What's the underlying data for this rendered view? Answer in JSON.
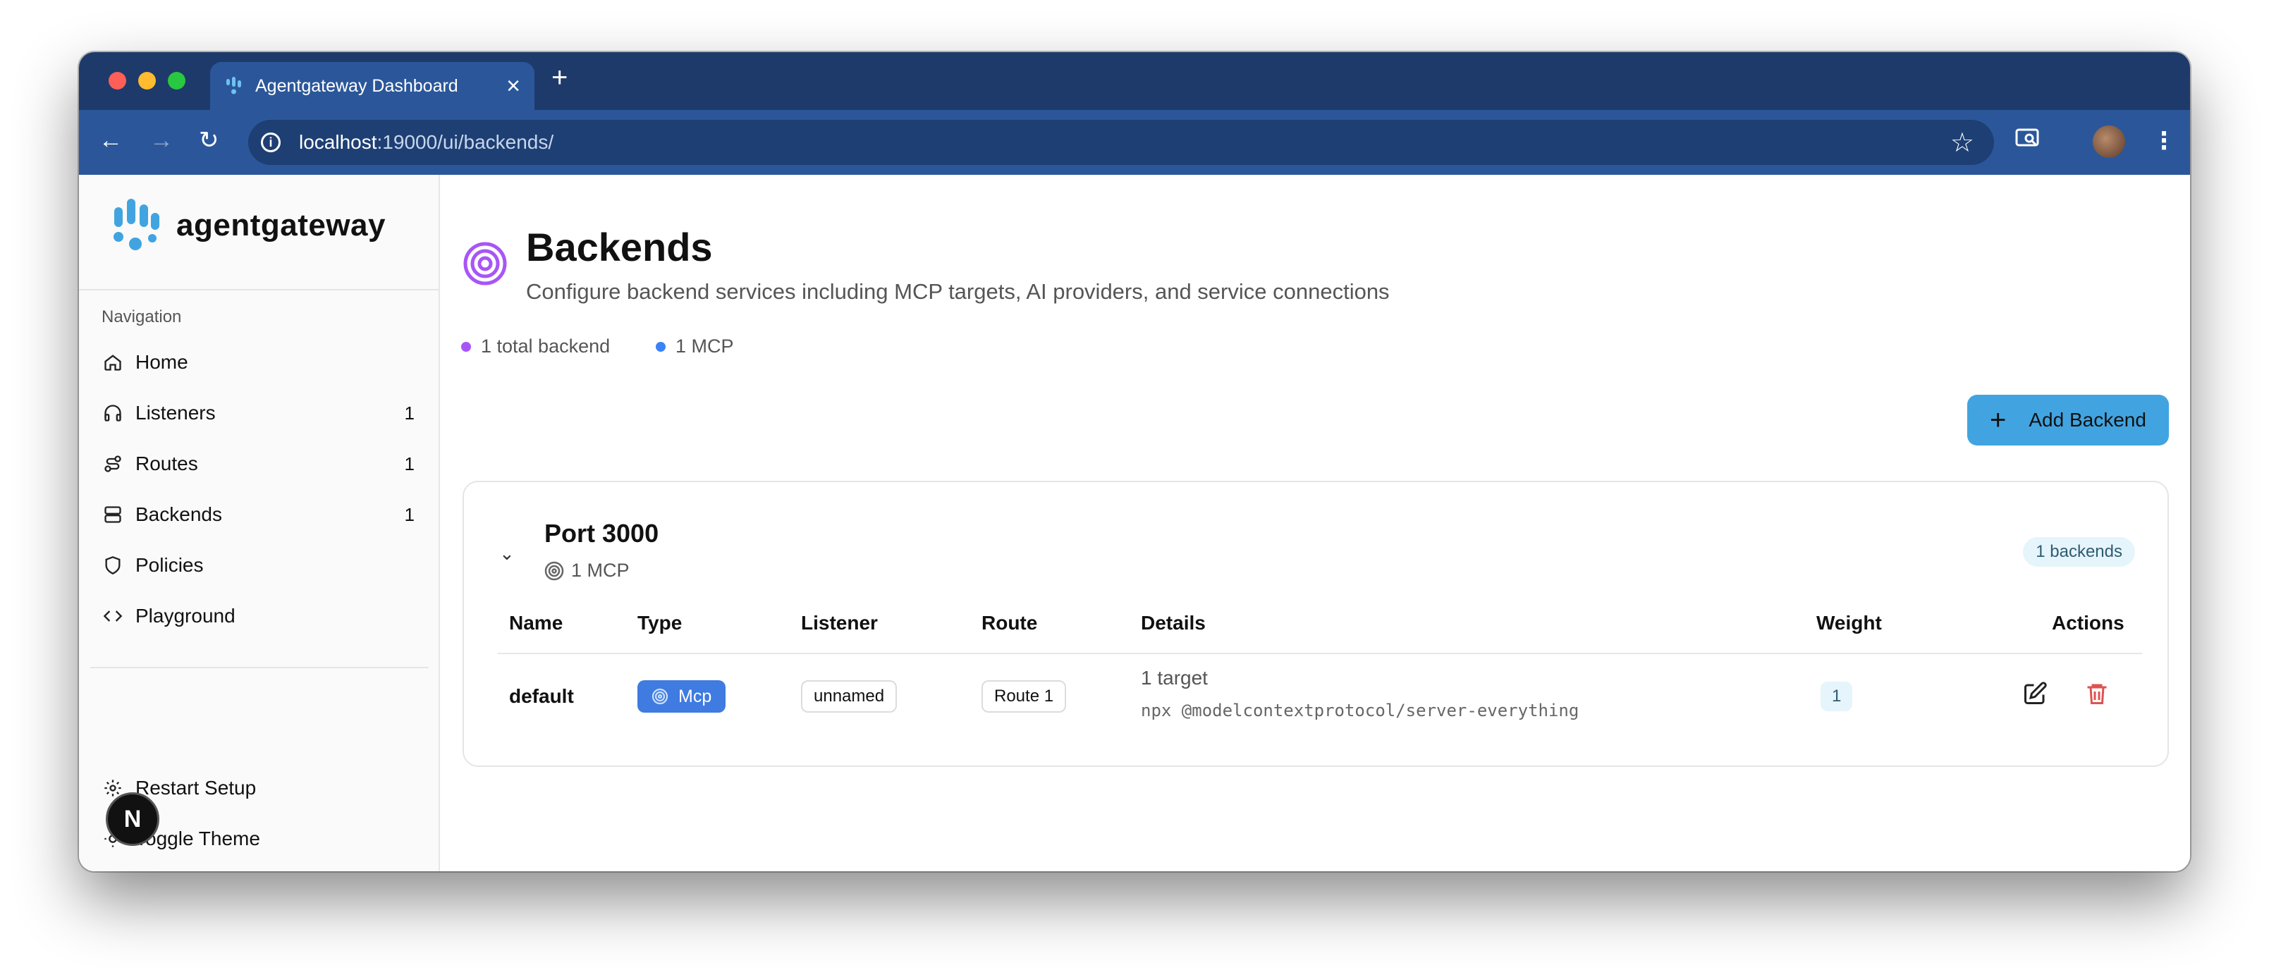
{
  "browser": {
    "tab_title": "Agentgateway Dashboard",
    "url_host": "localhost",
    "url_path": ":19000/ui/backends/",
    "colors": {
      "titlebar": "#1e3a6b",
      "toolbar": "#2b579a"
    }
  },
  "sidebar": {
    "brand": "agentgateway",
    "nav_label": "Navigation",
    "items": [
      {
        "label": "Home",
        "icon": "home-icon",
        "count": ""
      },
      {
        "label": "Listeners",
        "icon": "headphones-icon",
        "count": "1"
      },
      {
        "label": "Routes",
        "icon": "route-icon",
        "count": "1"
      },
      {
        "label": "Backends",
        "icon": "server-icon",
        "count": "1"
      },
      {
        "label": "Policies",
        "icon": "shield-icon",
        "count": ""
      },
      {
        "label": "Playground",
        "icon": "code-icon",
        "count": ""
      }
    ],
    "footer": [
      {
        "label": "Restart Setup",
        "icon": "gear-icon"
      },
      {
        "label": "Toggle Theme",
        "icon": "sun-icon"
      }
    ],
    "floating_badge": "N"
  },
  "main": {
    "title": "Backends",
    "subtitle": "Configure backend services including MCP targets, AI providers, and service connections",
    "stats": [
      {
        "label": "1 total backend",
        "color": "#a855f7"
      },
      {
        "label": "1 MCP",
        "color": "#3b82f6"
      }
    ],
    "add_button": "Add Backend",
    "accent": "#41a4e0"
  },
  "group": {
    "title": "Port 3000",
    "subtitle": "1 MCP",
    "count_badge": "1 backends",
    "columns": [
      "Name",
      "Type",
      "Listener",
      "Route",
      "Details",
      "Weight",
      "Actions"
    ],
    "rows": [
      {
        "name": "default",
        "type": "Mcp",
        "listener": "unnamed",
        "route": "Route 1",
        "details_line1": "1 target",
        "details_line2": "npx @modelcontextprotocol/server-everything",
        "weight": "1"
      }
    ]
  }
}
